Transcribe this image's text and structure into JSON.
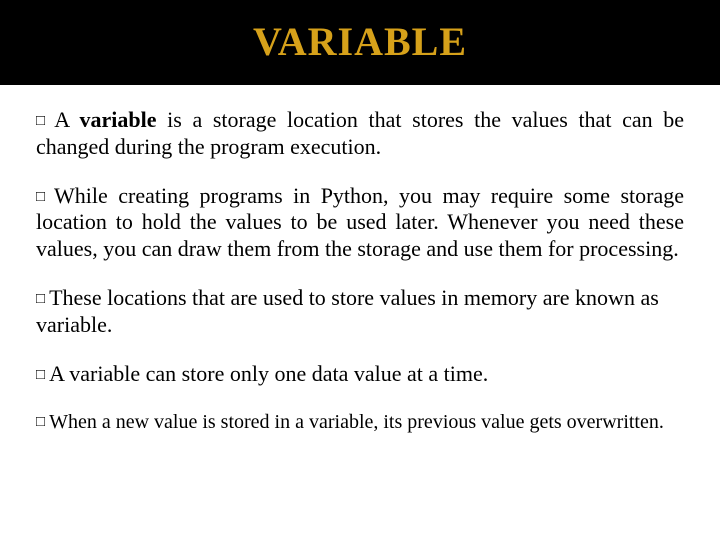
{
  "title": "VARIABLE",
  "bullets": {
    "b1_prefix": "A ",
    "b1_bold": "variable",
    "b1_rest": " is a storage location that stores the values that can be changed during the program execution.",
    "b2": "While creating programs in Python, you may require some storage location to hold the values to be used later. Whenever you need these values, you can draw them from the storage and use them for processing.",
    "b3": "These locations  that are used to store values in memory are known as variable.",
    "b4": "A variable can store only one data value at a time.",
    "b5": "When a new value is stored in a variable, its previous value gets overwritten."
  },
  "marker": "□"
}
